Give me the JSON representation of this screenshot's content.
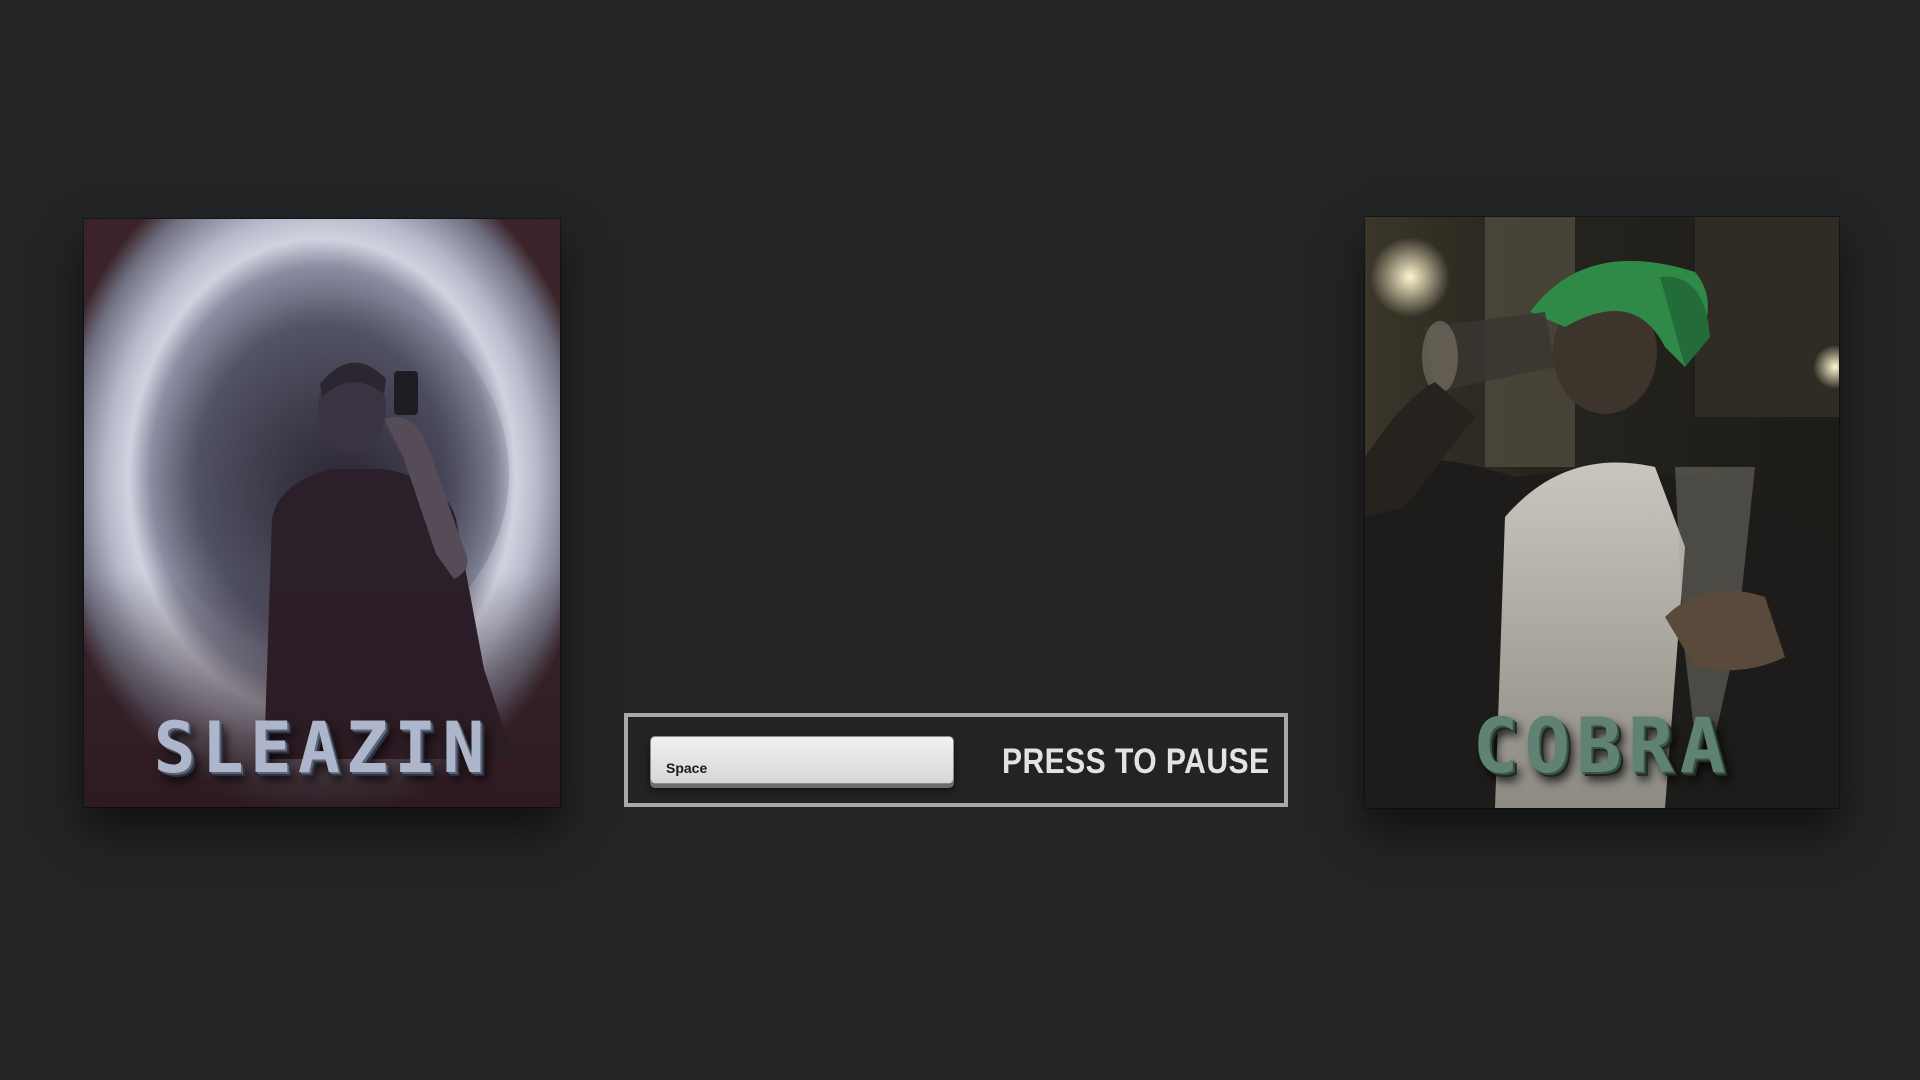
{
  "players": {
    "left": {
      "name": "SLEAZIN",
      "name_color": "#aeb6cc"
    },
    "right": {
      "name": "COBRA",
      "name_color": "#5f8272"
    }
  },
  "pause_hint": {
    "key_label": "Space",
    "action_text": "PRESS TO PAUSE"
  },
  "colors": {
    "background": "#232426",
    "hint_border": "#a9a9a9",
    "keycap_face": "#e2e2e2"
  }
}
